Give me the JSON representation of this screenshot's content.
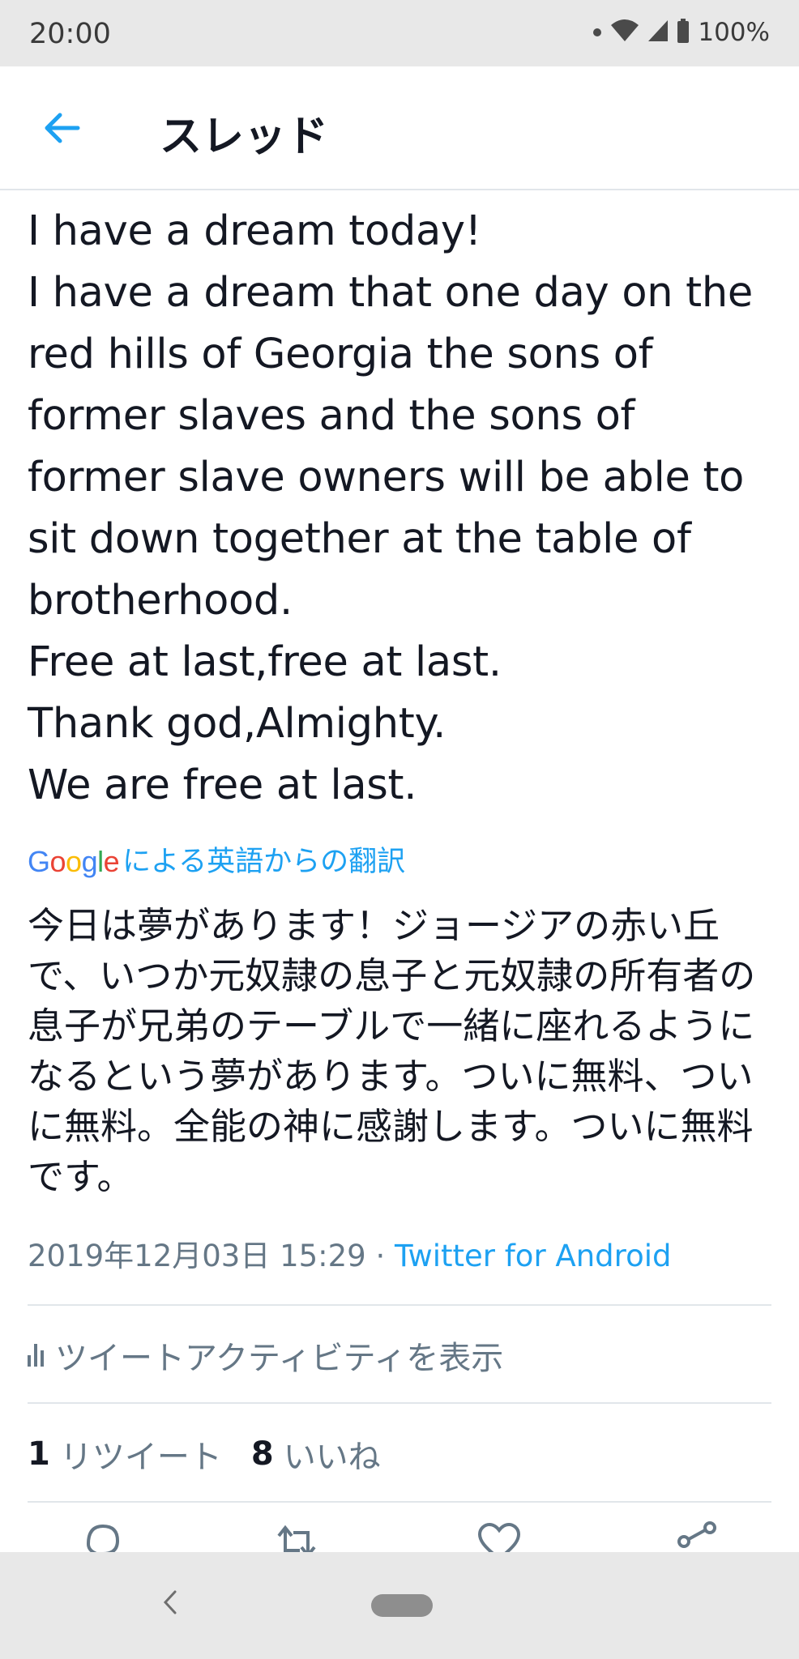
{
  "status_bar": {
    "time": "20:00",
    "battery": "100%",
    "icons": [
      "notification-dot-icon",
      "wifi-icon",
      "cellular-signal-icon",
      "battery-icon"
    ]
  },
  "app_bar": {
    "title": "スレッド",
    "back_icon": "arrow-left-icon",
    "accent_color": "#1da1f2"
  },
  "tweet": {
    "text": "I have a dream today!\nI have a dream that one day on the red hills of Georgia the sons of former slaves and the sons of former slave owners will be able to sit down together at the table of brotherhood.\nFree at last,free at last.\nThank god,Almighty.\nWe are free at last.",
    "translation_attribution": {
      "provider": "Google",
      "label": "による英語からの翻訳"
    },
    "translation": "今日は夢があります！ジョージアの赤い丘で、いつか元奴隷の息子と元奴隷の所有者の息子が兄弟のテーブルで一緒に座れるようになるという夢があります。ついに無料、ついに無料。全能の神に感謝します。ついに無料です。",
    "timestamp": "2019年12月03日 15:29",
    "separator": " · ",
    "source": "Twitter for Android"
  },
  "activity": {
    "label": "ツイートアクティビティを表示",
    "icon": "activity-bars-icon"
  },
  "counts": {
    "retweets": "1",
    "retweets_label": "リツイート",
    "likes": "8",
    "likes_label": "いいね"
  },
  "actions": [
    "reply-icon",
    "retweet-icon",
    "like-icon",
    "share-icon"
  ],
  "nav_bar": {
    "back_icon": "chevron-left-icon",
    "home_icon": "home-pill-icon"
  }
}
